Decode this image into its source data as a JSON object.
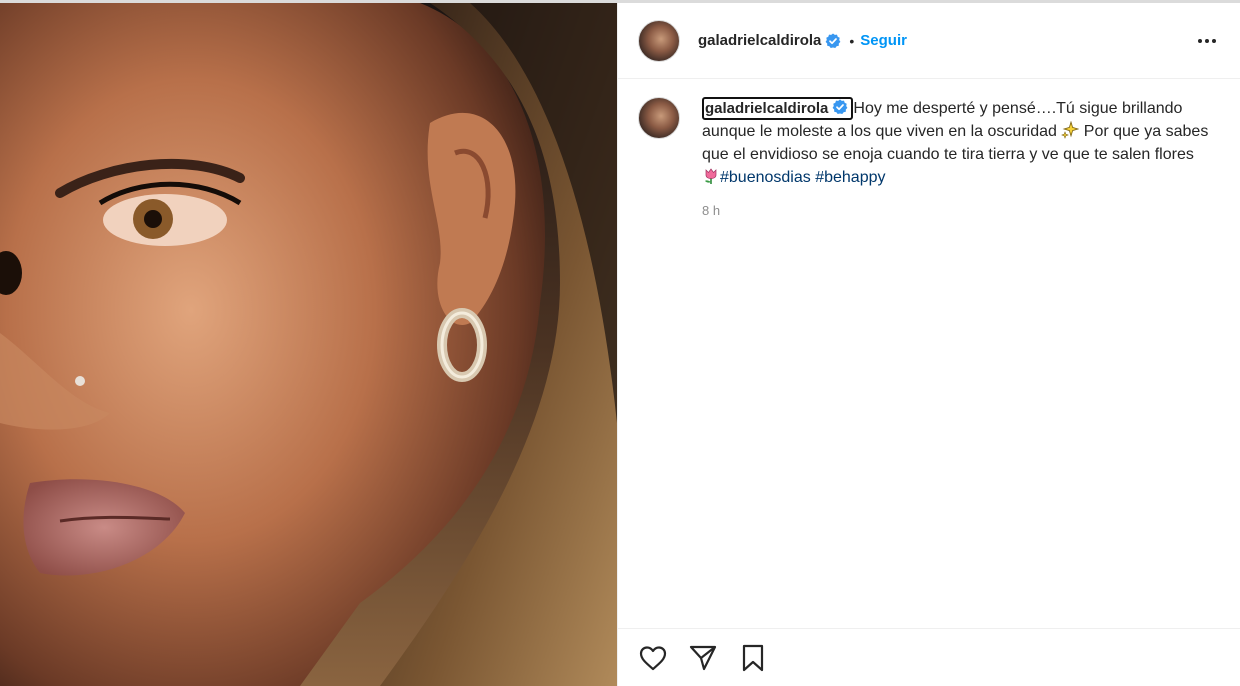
{
  "post": {
    "username": "galadrielcaldirola",
    "follow_label": "Seguir",
    "separator": "•"
  },
  "caption": {
    "username": "galadrielcaldirola",
    "text_part1": "Hoy me desperté y pensé….Tú sigue brillando aunque le moleste a los que viven en la oscuridad ",
    "text_part2": " Por que ya sabes que el envidioso se enoja cuando te tira tierra y ve que te salen flores ",
    "hashtags": [
      "#buenosdias",
      "#behappy"
    ],
    "time": "8 h"
  },
  "icons": {
    "verified": "verified-badge-icon",
    "sparkles": "sparkles-emoji",
    "tulip": "tulip-emoji",
    "like": "heart-icon",
    "share": "paper-plane-icon",
    "save": "bookmark-icon",
    "more": "more-options-icon"
  },
  "colors": {
    "accent": "#0095f6",
    "hashtag": "#00376b",
    "verified": "#3897f0",
    "muted": "#8e8e8e"
  }
}
